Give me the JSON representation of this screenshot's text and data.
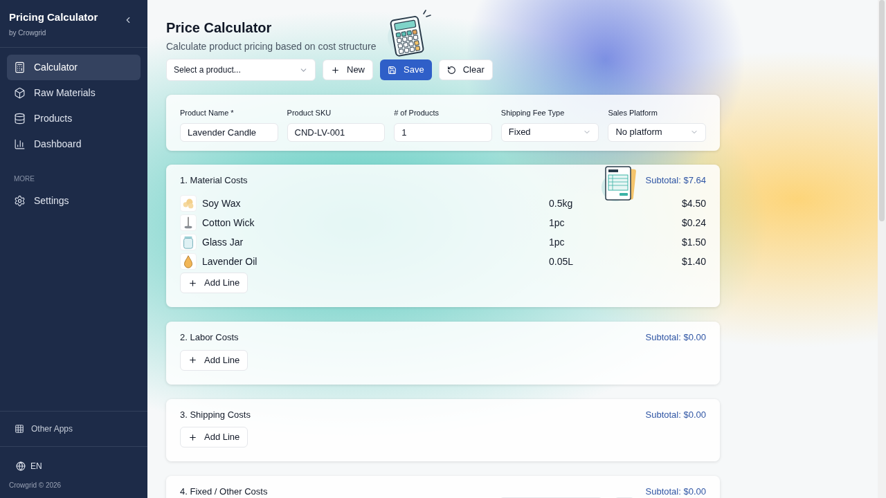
{
  "sidebar": {
    "app_title": "Pricing Calculator",
    "app_subtitle": "by Crowgrid",
    "items": [
      {
        "label": "Calculator",
        "selected": true
      },
      {
        "label": "Raw Materials",
        "selected": false
      },
      {
        "label": "Products",
        "selected": false
      },
      {
        "label": "Dashboard",
        "selected": false
      }
    ],
    "more_heading": "MORE",
    "more_items": [
      {
        "label": "Settings",
        "selected": false
      }
    ],
    "other_apps": "Other Apps",
    "language": "EN",
    "copyright": "Crowgrid © 2026"
  },
  "header": {
    "title": "Price Calculator",
    "subtitle": "Calculate product pricing based on cost structure"
  },
  "toolbar": {
    "product_select": {
      "placeholder": "Select a product..."
    },
    "buttons": [
      {
        "label": "New",
        "kind": "new"
      },
      {
        "label": "Save",
        "kind": "save"
      },
      {
        "label": "Clear",
        "kind": "clear"
      }
    ]
  },
  "product_form": [
    {
      "label": "Product Name *",
      "value": "Lavender Candle",
      "kind": "text"
    },
    {
      "label": "Product SKU",
      "value": "CND-LV-001",
      "kind": "text"
    },
    {
      "label": "# of Products",
      "value": "1",
      "kind": "text"
    },
    {
      "label": "Shipping Fee Type",
      "value": "Fixed",
      "kind": "select"
    },
    {
      "label": "Sales Platform",
      "value": "No platform",
      "kind": "select"
    }
  ],
  "sections": [
    {
      "title": "1. Material Costs",
      "subtotal": "Subtotal: $7.64",
      "kind": "lines",
      "add_label": "Add Line",
      "lines": [
        {
          "name": "Soy Wax",
          "quantity": "0.5kg",
          "price": "$4.50"
        },
        {
          "name": "Cotton Wick",
          "quantity": "1pc",
          "price": "$0.24"
        },
        {
          "name": "Glass Jar",
          "quantity": "1pc",
          "price": "$1.50"
        },
        {
          "name": "Lavender Oil",
          "quantity": "0.05L",
          "price": "$1.40"
        }
      ]
    },
    {
      "title": "2. Labor Costs",
      "subtotal": "Subtotal: $0.00",
      "kind": "lines",
      "add_label": "Add Line"
    },
    {
      "title": "3. Shipping Costs",
      "subtotal": "Subtotal: $0.00",
      "kind": "lines",
      "add_label": "Add Line"
    },
    {
      "title": "4. Fixed / Other Costs",
      "subtotal": "Subtotal: $0.00",
      "kind": "fixed"
    }
  ]
}
